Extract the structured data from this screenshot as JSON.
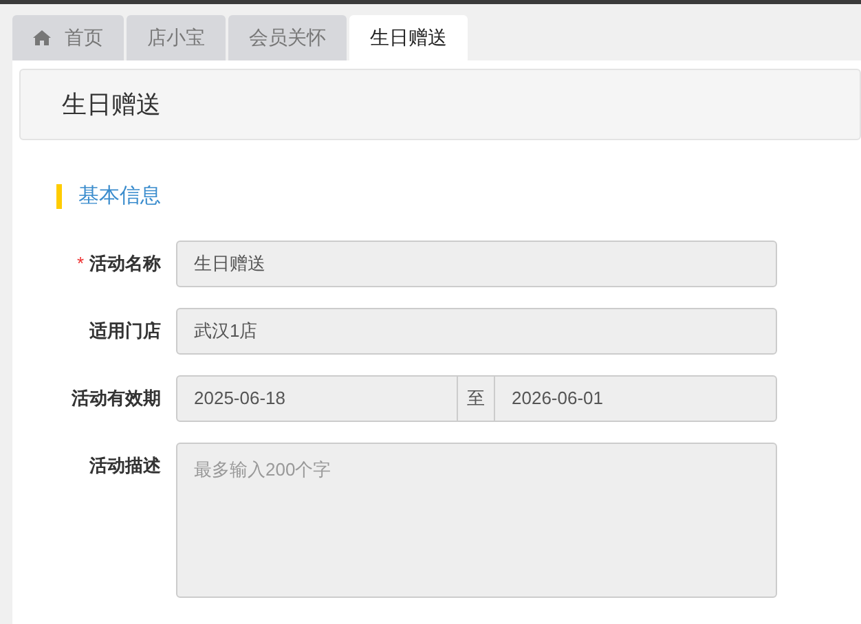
{
  "tabs": [
    {
      "label": "首页",
      "selected": false,
      "kind": "home"
    },
    {
      "label": "店小宝",
      "selected": false,
      "kind": "plain"
    },
    {
      "label": "会员关怀",
      "selected": false,
      "kind": "plain"
    },
    {
      "label": "生日赠送",
      "selected": true,
      "kind": "plain"
    }
  ],
  "page_title": "生日赠送",
  "section_title": "基本信息",
  "required_mark": "*",
  "form": [
    {
      "kind": "text",
      "label": "活动名称",
      "required": true,
      "disabled": true,
      "value": "生日赠送"
    },
    {
      "kind": "text",
      "label": "适用门店",
      "required": false,
      "disabled": true,
      "value": "武汉1店"
    },
    {
      "kind": "date_range",
      "label": "活动有效期",
      "required": false,
      "disabled": true,
      "start": "2025-06-18",
      "separator": "至",
      "end": "2026-06-01"
    },
    {
      "kind": "textarea",
      "label": "活动描述",
      "required": false,
      "disabled": true,
      "placeholder": "最多输入200个字"
    }
  ]
}
